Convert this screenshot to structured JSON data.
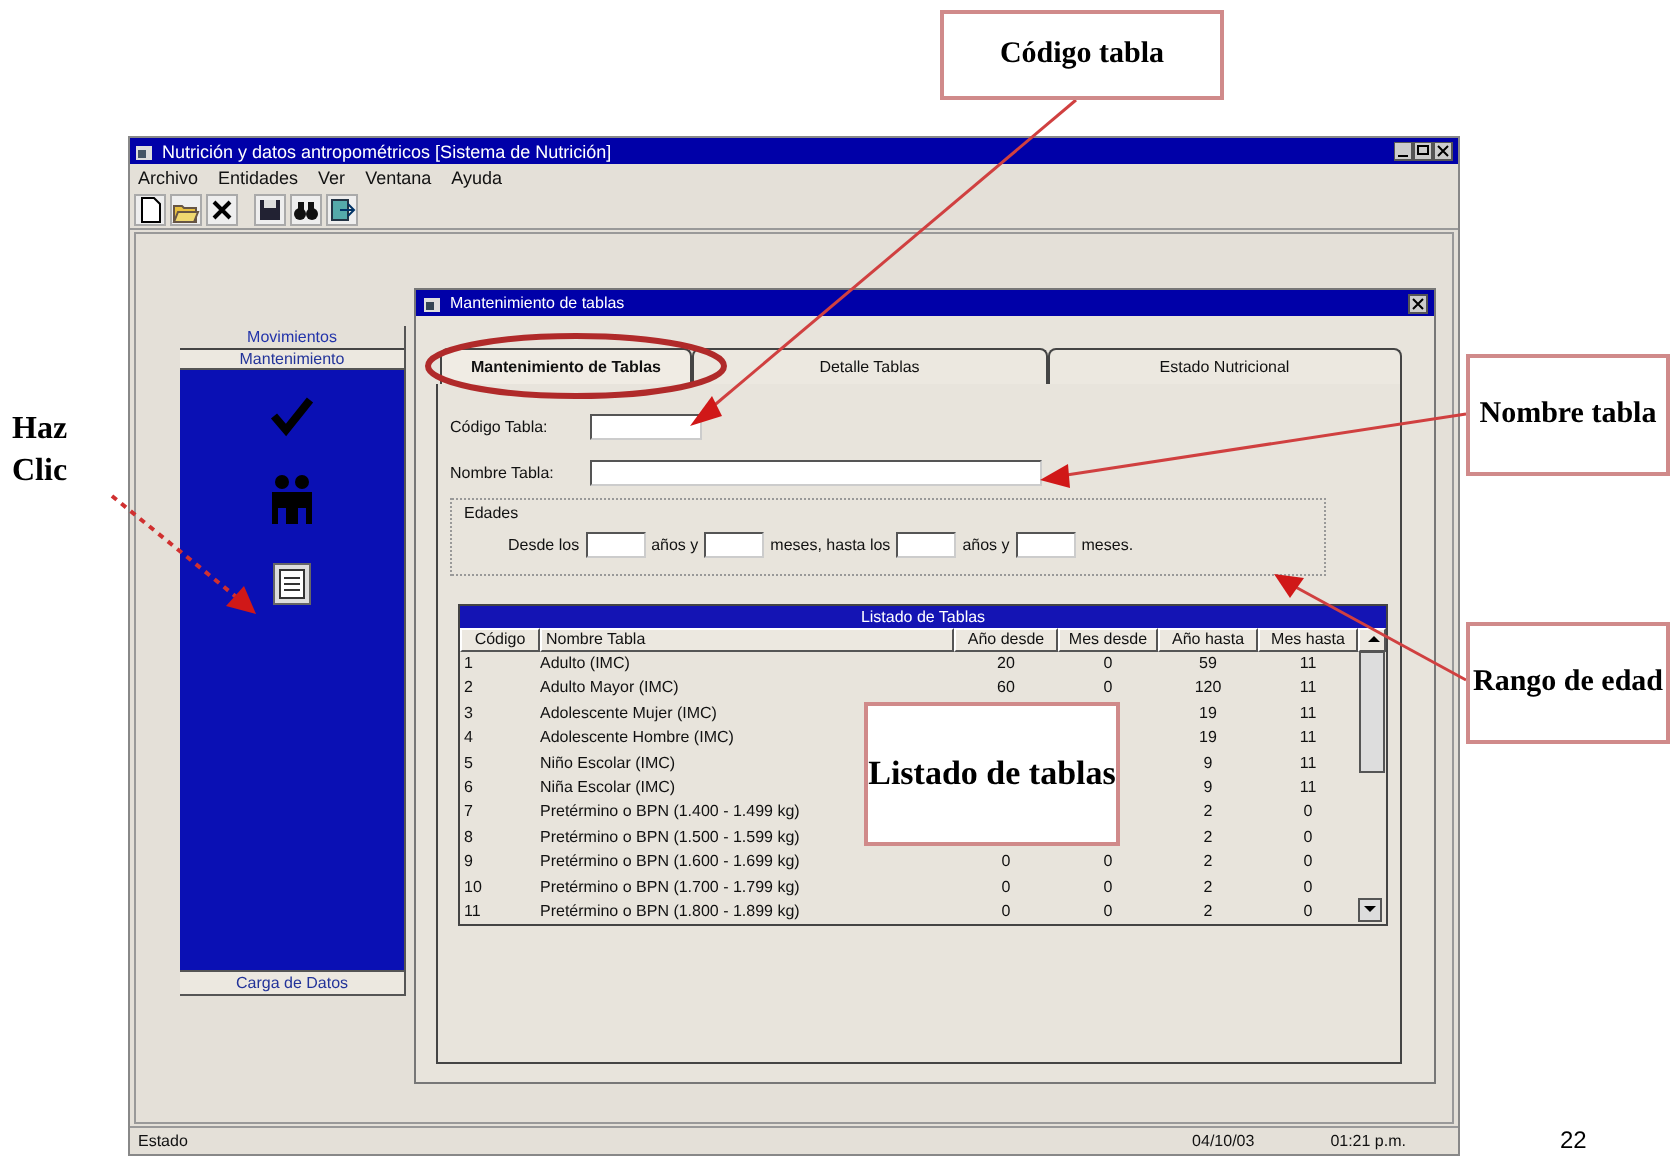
{
  "window": {
    "title": "Nutrición y datos antropométricos [Sistema de Nutrición]",
    "menu": [
      "Archivo",
      "Entidades",
      "Ver",
      "Ventana",
      "Ayuda"
    ]
  },
  "sidebar": {
    "header": "Movimientos",
    "open_section": "Mantenimiento",
    "bottom_section": "Carga de Datos"
  },
  "dialog": {
    "title": "Mantenimiento de tablas",
    "tabs": [
      {
        "label": "Mantenimiento de Tablas",
        "selected": true
      },
      {
        "label": "Detalle Tablas",
        "selected": false
      },
      {
        "label": "Estado Nutricional",
        "selected": false
      }
    ],
    "fields": [
      {
        "label": "Código Tabla:",
        "kind": "short"
      },
      {
        "label": "Nombre Tabla:",
        "kind": "long"
      }
    ],
    "age_group": {
      "title": "Edades",
      "parts": [
        "Desde los",
        "años y",
        "meses, hasta los",
        "años y",
        "meses."
      ]
    },
    "table": {
      "title": "Listado de Tablas",
      "columns": [
        "Código",
        "Nombre Tabla",
        "Año desde",
        "Mes desde",
        "Año hasta",
        "Mes hasta"
      ],
      "rows": [
        {
          "cells": [
            "1",
            "Adulto (IMC)",
            "20",
            "0",
            "59",
            "11"
          ]
        },
        {
          "cells": [
            "2",
            "Adulto Mayor (IMC)",
            "60",
            "0",
            "120",
            "11"
          ]
        },
        {
          "cells": [
            "3",
            "Adolescente Mujer (IMC)",
            null,
            null,
            "19",
            "11"
          ]
        },
        {
          "cells": [
            "4",
            "Adolescente Hombre (IMC)",
            null,
            null,
            "19",
            "11"
          ]
        },
        {
          "cells": [
            "5",
            "Niño Escolar (IMC)",
            null,
            null,
            "9",
            "11"
          ]
        },
        {
          "cells": [
            "6",
            "Niña Escolar (IMC)",
            null,
            null,
            "9",
            "11"
          ]
        },
        {
          "cells": [
            "7",
            "Pretérmino o BPN (1.400 - 1.499 kg)",
            null,
            null,
            "2",
            "0"
          ]
        },
        {
          "cells": [
            "8",
            "Pretérmino o BPN (1.500 - 1.599 kg)",
            null,
            null,
            "2",
            "0"
          ]
        },
        {
          "cells": [
            "9",
            "Pretérmino o BPN (1.600 - 1.699 kg)",
            "0",
            "0",
            "2",
            "0"
          ]
        },
        {
          "cells": [
            "10",
            "Pretérmino o BPN (1.700 - 1.799 kg)",
            "0",
            "0",
            "2",
            "0"
          ]
        },
        {
          "cells": [
            "11",
            "Pretérmino o BPN (1.800 - 1.899 kg)",
            "0",
            "0",
            "2",
            "0"
          ]
        }
      ]
    }
  },
  "status_bar": {
    "text": "Estado",
    "date": "04/10/03",
    "time": "01:21 p.m."
  },
  "annotations": [
    {
      "kind": "box",
      "text": "Código tabla"
    },
    {
      "kind": "box",
      "text": "Nombre tabla"
    },
    {
      "kind": "box",
      "text": "Rango de edad"
    },
    {
      "kind": "box",
      "text": "Listado de tablas"
    },
    {
      "kind": "plain",
      "text": "Haz Clic"
    }
  ],
  "page_number": "22"
}
